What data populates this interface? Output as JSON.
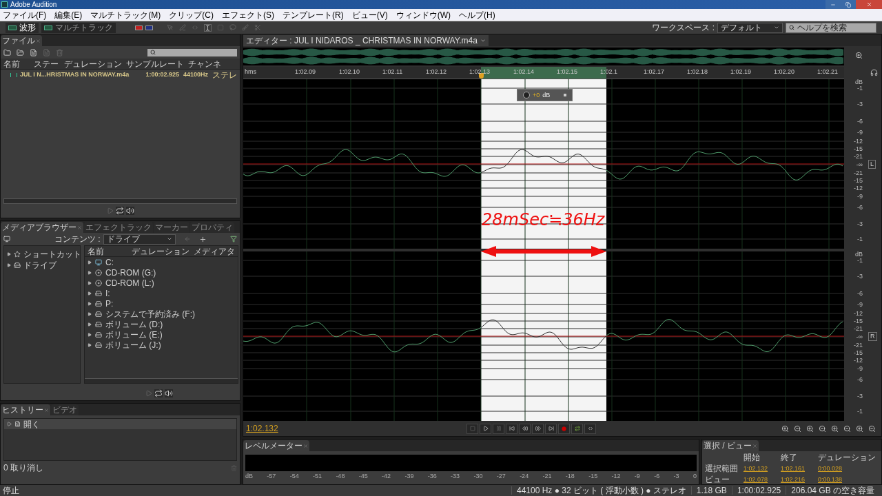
{
  "window": {
    "title": "Adobe Audition"
  },
  "menu": [
    "ファイル(F)",
    "編集(E)",
    "マルチトラック(M)",
    "クリップ(C)",
    "エフェクト(S)",
    "テンプレート(R)",
    "ビュー(V)",
    "ウィンドウ(W)",
    "ヘルプ(H)"
  ],
  "toolbar": {
    "modes": [
      {
        "label": "波形",
        "selected": true
      },
      {
        "label": "マルチトラック",
        "selected": false
      }
    ],
    "workspace_label": "ワークスペース :",
    "workspace_value": "デフォルト",
    "help_placeholder": "ヘルプを検索"
  },
  "files_panel": {
    "tab": "ファイル",
    "columns": [
      "名前",
      "ステー",
      "デュレーション",
      "サンプルレート",
      "チャンネ"
    ],
    "rows": [
      {
        "name": "JUL I N...HRISTMAS IN NORWAY.m4a",
        "duration": "1:00:02.925",
        "sample_rate": "44100Hz",
        "channels": "ステレ",
        "selected": false
      }
    ]
  },
  "media_browser": {
    "tabs": [
      {
        "label": "メディアブラウザー",
        "selected": true
      },
      {
        "label": "エフェクトラック",
        "selected": false
      },
      {
        "label": "マーカー",
        "selected": false
      },
      {
        "label": "プロパティ",
        "selected": false
      }
    ],
    "content_label": "コンテンツ :",
    "content_value": "ドライブ",
    "tree": [
      {
        "label": "ショートカット",
        "kind": "shortcut"
      },
      {
        "label": "ドライブ",
        "kind": "drive"
      }
    ],
    "columns": [
      "名前",
      "デュレーション",
      "メディアタ"
    ],
    "rows": [
      {
        "name": "C:",
        "kind": "system"
      },
      {
        "name": "CD-ROM (G:)",
        "kind": "cd"
      },
      {
        "name": "CD-ROM (L:)",
        "kind": "cd"
      },
      {
        "name": "I:",
        "kind": "drive"
      },
      {
        "name": "P:",
        "kind": "drive"
      },
      {
        "name": "システムで予約済み (F:)",
        "kind": "drive"
      },
      {
        "name": "ボリューム (D:)",
        "kind": "drive"
      },
      {
        "name": "ボリューム (E:)",
        "kind": "drive"
      },
      {
        "name": "ボリューム (J:)",
        "kind": "drive"
      }
    ]
  },
  "history": {
    "tabs": [
      {
        "label": "ヒストリー",
        "selected": true
      },
      {
        "label": "ビデオ",
        "selected": false
      }
    ],
    "items": [
      "開く"
    ],
    "undo_count": "0 取り消し"
  },
  "editor": {
    "tab": "エディター : JUL I NIDAROS _ CHRISTMAS IN NORWAY.m4a",
    "ruler": [
      "hms",
      "1:02.09",
      "1:02.10",
      "1:02.11",
      "1:02.12",
      "1:02.13",
      "1:02.14",
      "1:02.15",
      "1:02.1",
      "1:02.17",
      "1:02.18",
      "1:02.19",
      "1:02.20",
      "1:02.21"
    ],
    "hud": {
      "value": "+0",
      "unit": "dB"
    },
    "channels": [
      {
        "label": "L",
        "scale": [
          "dB",
          "-1",
          "-3",
          "-6",
          "-9",
          "-12",
          "-15",
          "-21",
          "-∞",
          "-21",
          "-15",
          "-12",
          "-9",
          "-6",
          "-3",
          "-1"
        ]
      },
      {
        "label": "R",
        "scale": [
          "dB",
          "-1",
          "-3",
          "-6",
          "-9",
          "-12",
          "-15",
          "-21",
          "-∞",
          "-21",
          "-15",
          "-12",
          "-9",
          "-6",
          "-3",
          "-1"
        ]
      }
    ],
    "annotation": "28mSec≒36Hz",
    "current_time": "1:02.132"
  },
  "level_meter": {
    "tab": "レベルメーター",
    "scale": [
      "dB",
      "-57",
      "-54",
      "-51",
      "-48",
      "-45",
      "-42",
      "-39",
      "-36",
      "-33",
      "-30",
      "-27",
      "-24",
      "-21",
      "-18",
      "-15",
      "-12",
      "-9",
      "-6",
      "-3",
      "0"
    ]
  },
  "selection_view": {
    "tab": "選択 / ビュー",
    "headers": [
      "開始",
      "終了",
      "デュレーション"
    ],
    "rows": [
      {
        "label": "選択範囲",
        "values": [
          "1:02.132",
          "1:02.161",
          "0:00.028"
        ]
      },
      {
        "label": "ビュー",
        "values": [
          "1:02.078",
          "1:02.216",
          "0:00.138"
        ]
      }
    ]
  },
  "status_bar": {
    "state": "停止",
    "items": [
      "44100 Hz ● 32 ビット ( 浮動小数 ) ● ステレオ",
      "1.18 GB",
      "1:00:02.925",
      "206.04 GB の空き容量"
    ]
  }
}
